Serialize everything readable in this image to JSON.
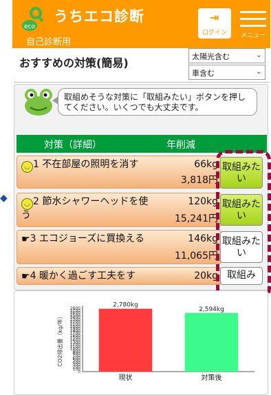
{
  "header": {
    "logo_text": "eco",
    "app_name": "うちエコ診断",
    "subtitle": "自己診断用",
    "login_label": "ログイン",
    "menu_label": "メニュー"
  },
  "page": {
    "title": "おすすめの対策(簡易)",
    "select1": "太陽光含む",
    "select2": "車含む"
  },
  "mascot": {
    "message": "取組めそうな対策に「取組みたい」ボタンを押してください。いくつでも大丈夫です。"
  },
  "table": {
    "header_measure": "対策（詳細）",
    "header_cut": "年削減",
    "rows": [
      {
        "num": "1",
        "icon": "smile-icon",
        "label": "不在部屋の照明を消す",
        "kg": "66kg",
        "yen": "3,818円",
        "button": "取組みたい",
        "button_style": "green"
      },
      {
        "num": "2",
        "icon": "smile-icon",
        "label": "節水シャワーヘッドを使う",
        "kg": "120kg",
        "yen": "15,241円",
        "button": "取組みたい",
        "button_style": "green"
      },
      {
        "num": "3",
        "icon": "pointing-hand-icon",
        "label": "エコジョーズに買換える",
        "kg": "146kg",
        "yen": "11,065円",
        "button": "取組みたい",
        "button_style": "white"
      },
      {
        "num": "4",
        "icon": "pointing-hand-icon",
        "label": "暖かく過ごす工夫をす",
        "kg": "20kg",
        "yen": "",
        "button": "取組み",
        "button_style": "white"
      }
    ]
  },
  "chart_data": {
    "type": "bar",
    "categories": [
      "現状",
      "対策後"
    ],
    "values": [
      2780,
      2594
    ],
    "data_labels": [
      "2,780kg",
      "2,594kg"
    ],
    "ylabel": "CO2排出量（kg/年）",
    "yticks": [
      0,
      100,
      200,
      300,
      400,
      500,
      600,
      700,
      800,
      900,
      1000,
      1100,
      1200,
      1300,
      1400,
      1500,
      1600,
      1700,
      1800,
      1900,
      2000,
      2100,
      2200,
      2300,
      2400,
      2500,
      2600,
      2700,
      2800
    ],
    "ylim": [
      0,
      2800
    ],
    "colors": [
      "#ff3b3b",
      "#3dfa8c"
    ]
  },
  "colors": {
    "accent": "#ff9900",
    "table_header": "#009c3b",
    "highlight_dash": "#9a0f3a"
  },
  "side_marker": "◆"
}
